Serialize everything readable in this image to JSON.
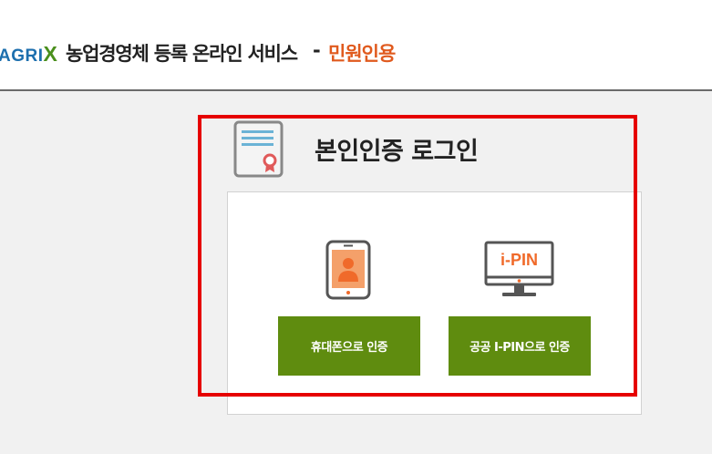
{
  "header": {
    "logo_text": "AGRI",
    "logo_x": "X",
    "title": "농업경영체 등록 온라인 서비스",
    "separator": "-",
    "subtitle": "민원인용"
  },
  "login": {
    "heading": "본인인증 로그인",
    "ipin_icon_label": "i-PIN",
    "phone_button": "휴대폰으로 인증",
    "ipin_button": "공공 I-PIN으로 인증"
  },
  "colors": {
    "brand_green": "#5f8c0f",
    "accent_orange": "#e05a1e",
    "highlight_red": "#e60000"
  },
  "icons": [
    "certificate-icon",
    "smartphone-icon",
    "ipin-monitor-icon"
  ]
}
